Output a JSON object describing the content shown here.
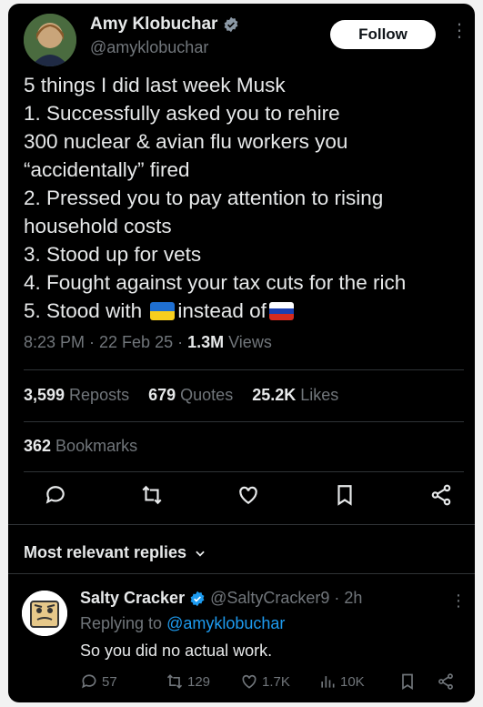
{
  "tweet": {
    "author_name": "Amy Klobuchar",
    "author_handle": "@amyklobuchar",
    "follow_label": "Follow",
    "more_label": "⋮",
    "lines": [
      "5 things I did last week Musk",
      "1. Successfully asked you to rehire",
      "300 nuclear & avian flu workers you",
      "“accidentally” fired",
      "2. Pressed you to pay attention to rising",
      "household costs",
      "3. Stood up for vets",
      "4. Fought against your tax cuts for the rich"
    ],
    "last_line_a": "5. Stood with",
    "last_line_b": "instead of",
    "time": "8:23 PM · 22 Feb 25 · ",
    "views_count": "1.3M",
    "views_label": " Views",
    "reposts_count": "3,599",
    "reposts_label": " Reposts",
    "quotes_count": "679",
    "quotes_label": " Quotes",
    "likes_count": "25.2K",
    "likes_label": " Likes",
    "bookmarks_count": "362",
    "bookmarks_label": " Bookmarks"
  },
  "replies_header": "Most relevant replies",
  "reply": {
    "author_name": "Salty Cracker",
    "author_handle": "@SaltyCracker9 · 2h",
    "replying_prefix": "Replying to ",
    "replying_handle": "@amyklobuchar",
    "text": "So you did no actual work.",
    "replies": "57",
    "reposts": "129",
    "likes": "1.7K",
    "views": "10K"
  },
  "colors": {
    "background": "#000000",
    "text": "#e7e9ea",
    "muted": "#71767b",
    "accent": "#1d9bf0",
    "divider": "#2f3336"
  },
  "icons": [
    "verified-badge-icon",
    "reply-icon",
    "repost-icon",
    "like-icon",
    "bookmark-icon",
    "share-icon",
    "chevron-down-icon",
    "views-icon",
    "ukraine-flag-icon",
    "russia-flag-icon"
  ]
}
